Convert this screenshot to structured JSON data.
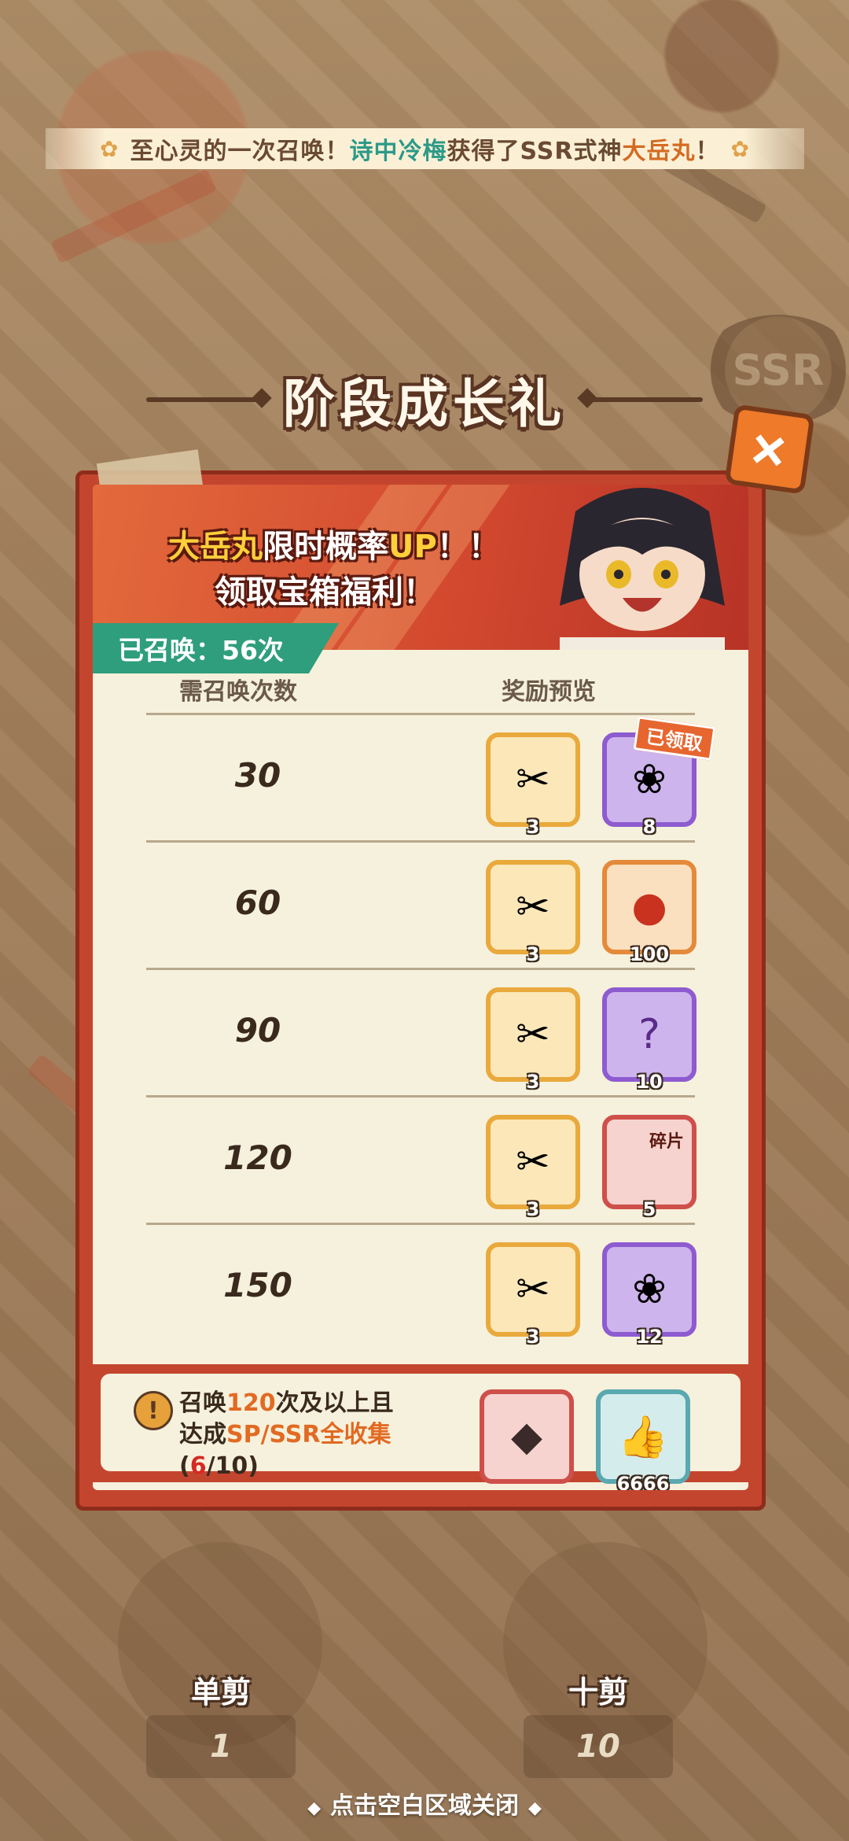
{
  "announcement": {
    "prefix": "至心灵的一次召唤！",
    "player": "诗中冷梅",
    "middle": "获得了SSR式神",
    "shikigami": "大岳丸",
    "suffix": "！"
  },
  "background_coin": "SSR",
  "popup": {
    "title": "阶段成长礼",
    "close_icon": "close-icon",
    "promo": {
      "name": "大岳丸",
      "line1_rest": "限时概率",
      "up": "UP",
      "line1_end": "！！",
      "line2": "领取宝箱福利！"
    },
    "summoned_label": "已召唤：56次",
    "columns": {
      "count": "需召唤次数",
      "rewards": "奖励预览"
    },
    "rows": [
      {
        "count": "30",
        "reward1_qty": "3",
        "reward2_qty": "8",
        "claimed": "已领取"
      },
      {
        "count": "60",
        "reward1_qty": "3",
        "reward2_qty": "100"
      },
      {
        "count": "90",
        "reward1_qty": "3",
        "reward2_qty": "10"
      },
      {
        "count": "120",
        "reward1_qty": "3",
        "reward2_qty": "5",
        "reward2_tag": "碎片"
      },
      {
        "count": "150",
        "reward1_qty": "3",
        "reward2_qty": "12"
      }
    ],
    "condition": {
      "line1_a": "召唤",
      "line1_num": "120",
      "line1_b": "次及以上且",
      "line2_a": "达成",
      "line2_hl": "SP/SSR全收集",
      "line3_open": "(",
      "progress_current": "6",
      "progress_total": "/10)",
      "reward2_qty": "6666"
    }
  },
  "bottom": {
    "single_label": "单剪",
    "single_value": "1",
    "ten_label": "十剪",
    "ten_value": "10",
    "close_hint": "点击空白区域关闭"
  },
  "colors": {
    "panel_red": "#c4452e",
    "summoned_tag": "#2f9e7c",
    "highlight_orange": "#e26a22"
  }
}
